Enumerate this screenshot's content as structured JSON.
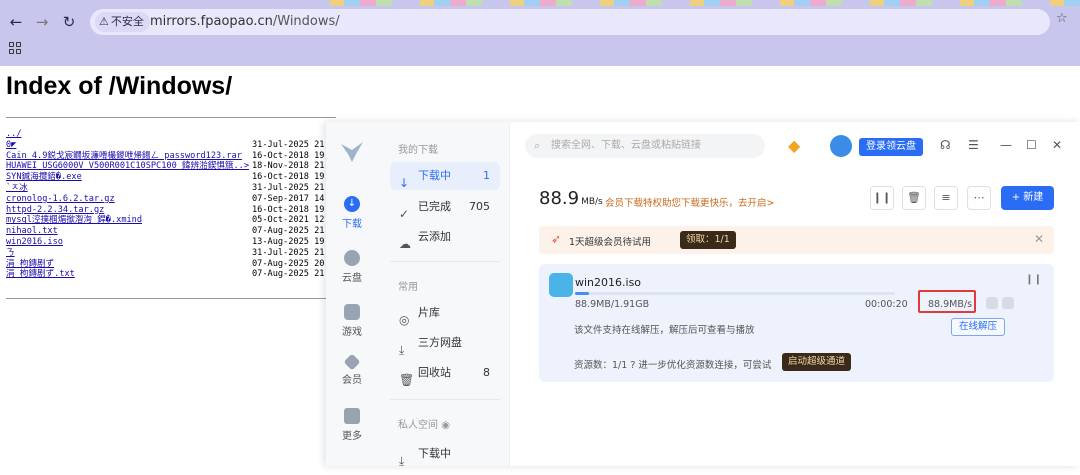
{
  "browser": {
    "security_badge": "不安全",
    "url_host": "mirrors.fpaopao.cn",
    "url_path": "/Windows/"
  },
  "page": {
    "title": "Index of /Windows/",
    "entries": [
      {
        "name": "../",
        "date": ""
      },
      {
        "name": "0◤",
        "date": "31-Jul-2025 21:"
      },
      {
        "name": "Cain_4.9鋭戈宸鐗坂濂嗗樶鍐呭帰鍚ㄥ password123.rar",
        "date": "16-Oct-2018 19:"
      },
      {
        "name": "HUAWEI_USG6000V_V500R001C10SPC100_鍏辨湁鍥惧簱..>",
        "date": "18-Nov-2018 21"
      },
      {
        "name": "SYN鍼海攬鍣�.exe",
        "date": "16-Oct-2018 19"
      },
      {
        "name": "`ㅈ冰",
        "date": "31-Jul-2025 21:"
      },
      {
        "name": "cronolog-1.6.2.tar.gz",
        "date": "07-Sep-2017 14:"
      },
      {
        "name": "httpd-2.2.34.tar.gz",
        "date": "16-Oct-2018 19:"
      },
      {
        "name": "mysql涳撲椢煝撳潪洵 銲�.xmind",
        "date": "05-Oct-2021 12"
      },
      {
        "name": "nihaol.txt",
        "date": "07-Aug-2025 21:"
      },
      {
        "name": "win2016.iso",
        "date": "13-Aug-2025 19:"
      },
      {
        "name": "ㄋ",
        "date": "31-Jul-2025 21:"
      },
      {
        "name": "涓  枸鏄剧ず",
        "date": "07-Aug-2025 20:"
      },
      {
        "name": "涓  枸鏄剧ず.txt",
        "date": "07-Aug-2025 21:"
      }
    ]
  },
  "app": {
    "rail": [
      {
        "label": "下载",
        "icon": "download-icon"
      },
      {
        "label": "云盘",
        "icon": "cloud-icon"
      },
      {
        "label": "游戏",
        "icon": "gamepad-icon"
      },
      {
        "label": "会员",
        "icon": "diamond-icon"
      },
      {
        "label": "更多",
        "icon": "grid-icon"
      }
    ],
    "side": {
      "my_downloads": "我的下载",
      "downloading": "下载中",
      "downloading_count": "1",
      "completed": "已完成",
      "completed_count": "705",
      "cloud_add": "云添加",
      "common": "常用",
      "library": "片库",
      "third_party": "三方网盘",
      "recycle": "回收站",
      "recycle_count": "8",
      "private": "私人空间",
      "private_downloading": "下载中"
    },
    "search_placeholder": "搜索全网、下载、云盘或粘贴链接",
    "login_label": "登录领云盘",
    "speed_value": "88.9",
    "speed_unit": "MB/s",
    "promo_text": "会员下载特权助您下载更快乐，去开启>",
    "new_label": "新建",
    "trial_text": "1天超级会员待试用",
    "trial_claim": "领取：1/1",
    "task": {
      "filename": "win2016.iso",
      "size": "88.9MB/1.91GB",
      "eta": "00:00:20",
      "rate": "88.9MB/s",
      "progress": 0.045,
      "online_note": "该文件支持在线解压，解压后可查看与播放",
      "online_btn": "在线解压",
      "resources": "资源数：1/1",
      "resources_hint": "进一步优化资源数连接，可尝试",
      "boost_btn": "启动超级通道"
    }
  }
}
